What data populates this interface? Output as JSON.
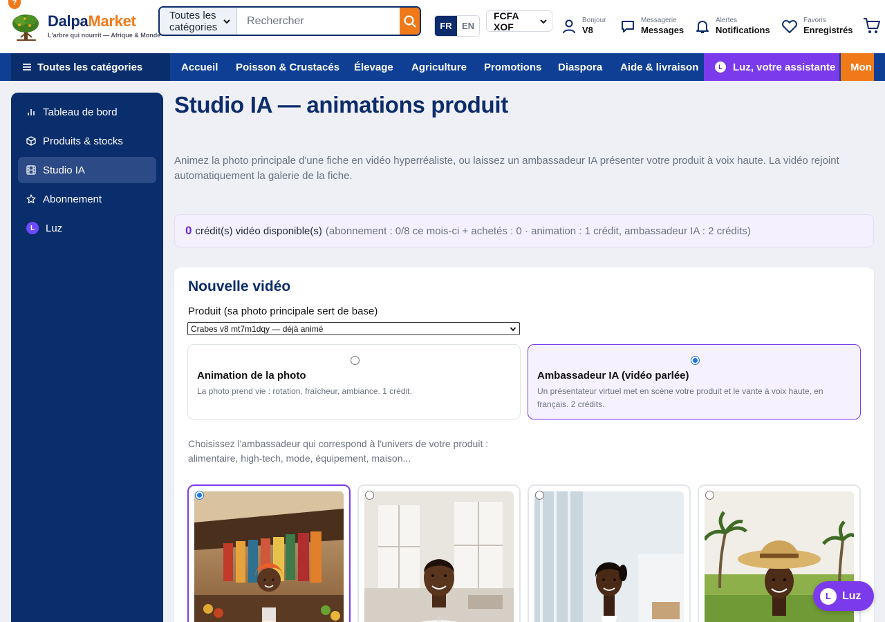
{
  "header": {
    "help_icon": "?",
    "logo": {
      "name_part1": "Dalpa",
      "name_part2": "Market",
      "tagline": "L'arbre qui nourrit — Afrique & Monde"
    },
    "search": {
      "category": "Toutes les catégories",
      "placeholder": "Rechercher"
    },
    "lang": {
      "active": "FR",
      "other": "EN"
    },
    "currency": "FCFA XOF",
    "account": {
      "small": "Bonjour",
      "big": "V8"
    },
    "messages": {
      "small": "Messagerie",
      "big": "Messages"
    },
    "alerts": {
      "small": "Alertes",
      "big": "Notifications"
    },
    "favorites": {
      "small": "Favoris",
      "big": "Enregistrés"
    }
  },
  "nav": {
    "all_categories": "Toutes les catégories",
    "links": [
      "Accueil",
      "Poisson & Crustacés",
      "Élevage",
      "Agriculture",
      "Promotions",
      "Diaspora",
      "Aide & livraison"
    ],
    "luz_badge": "L",
    "luz": "Luz, votre assistante",
    "more": "Mon"
  },
  "sidebar": {
    "items": [
      {
        "label": "Tableau de bord",
        "icon": "bar-chart-icon"
      },
      {
        "label": "Produits & stocks",
        "icon": "box-icon"
      },
      {
        "label": "Studio IA",
        "icon": "film-icon",
        "active": true
      },
      {
        "label": "Abonnement",
        "icon": "star-icon"
      },
      {
        "label": "Luz",
        "icon": "luz-icon",
        "badge": "L"
      }
    ]
  },
  "main": {
    "title": "Studio IA — animations produit",
    "intro": "Animez la photo principale d'une fiche en vidéo hyperréaliste, ou laissez un ambassadeur IA présenter votre produit à voix haute. La vidéo rejoint automatiquement la galerie de la fiche.",
    "credits": {
      "count": "0",
      "label": "crédit(s) vidéo disponible(s)",
      "detail": "(abonnement : 0/8 ce mois-ci + achetés : 0 · animation : 1 crédit, ambassadeur IA : 2 crédits)"
    },
    "form": {
      "title": "Nouvelle vidéo",
      "product_label": "Produit (sa photo principale sert de base)",
      "product_value": "Crabes v8 mt7m1dqy — déjà animé",
      "modes": [
        {
          "title": "Animation de la photo",
          "desc": "La photo prend vie : rotation, fraîcheur, ambiance. 1 crédit.",
          "selected": false
        },
        {
          "title": "Ambassadeur IA (vidéo parlée)",
          "desc": "Un présentateur virtuel met en scène votre produit et le vante à voix haute, en français. 2 crédits.",
          "selected": true
        }
      ],
      "helper": "Choisissez l'ambassadeur qui correspond à l'univers de votre produit : alimentaire, high-tech, mode, équipement, maison..."
    }
  },
  "luz_float": {
    "badge": "L",
    "label": "Luz"
  },
  "colors": {
    "navy": "#0d2c6b",
    "nav_blue": "#0e3f94",
    "orange": "#f07a1a",
    "purple": "#7c3aed",
    "sidebar": "#0a2d6c"
  }
}
